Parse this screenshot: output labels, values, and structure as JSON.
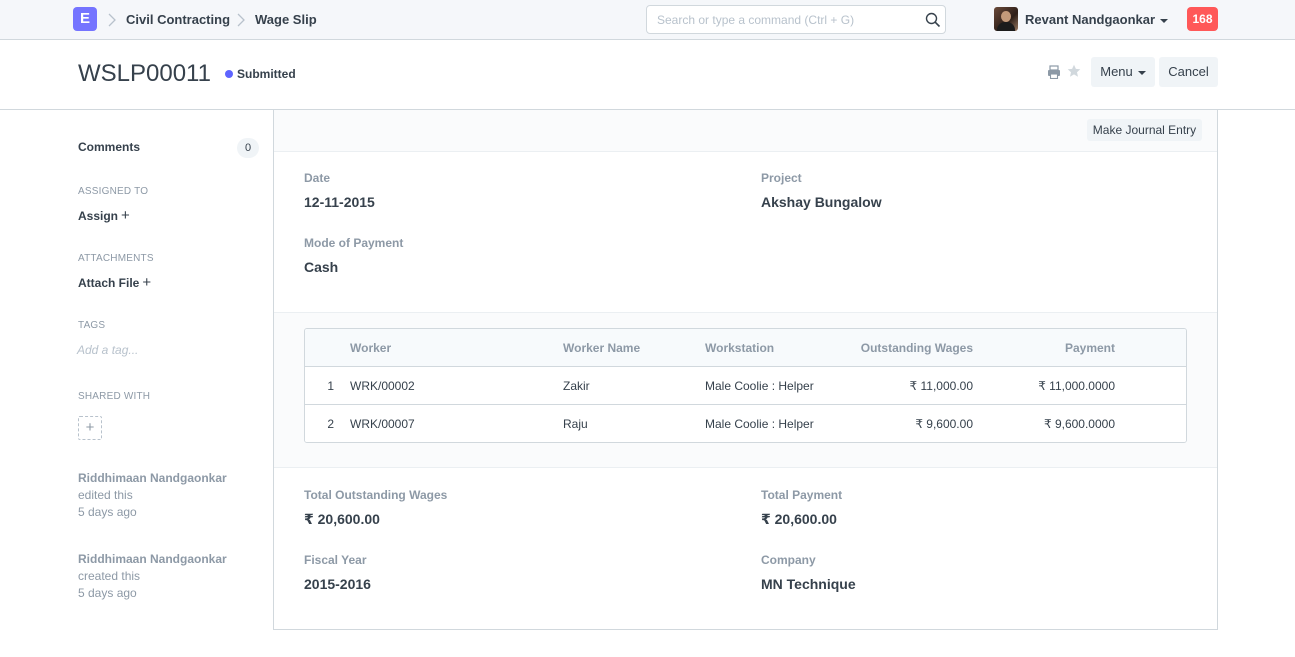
{
  "navbar": {
    "logo_letter": "E",
    "breadcrumbs": [
      "Civil Contracting",
      "Wage Slip"
    ],
    "search_placeholder": "Search or type a command (Ctrl + G)",
    "user_name": "Revant Nandgaonkar",
    "notification_count": "168"
  },
  "page_head": {
    "title": "WSLP00011",
    "status": "Submitted",
    "status_color": "#5e64ff",
    "menu_label": "Menu",
    "cancel_label": "Cancel"
  },
  "sidebar": {
    "comments_label": "Comments",
    "comments_count": "0",
    "assigned_heading": "ASSIGNED TO",
    "assign_label": "Assign",
    "attachments_heading": "ATTACHMENTS",
    "attach_label": "Attach File",
    "tags_heading": "TAGS",
    "tag_placeholder": "Add a tag...",
    "shared_heading": "SHARED WITH",
    "timeline": [
      {
        "name": "Riddhimaan Nandgaonkar",
        "action": "edited this",
        "when": "5 days ago"
      },
      {
        "name": "Riddhimaan Nandgaonkar",
        "action": "created this",
        "when": "5 days ago"
      }
    ]
  },
  "form": {
    "toolbar_button": "Make Journal Entry",
    "date_label": "Date",
    "date_value": "12-11-2015",
    "project_label": "Project",
    "project_value": "Akshay Bungalow",
    "mode_label": "Mode of Payment",
    "mode_value": "Cash",
    "table": {
      "columns": [
        "Worker",
        "Worker Name",
        "Workstation",
        "Outstanding Wages",
        "Payment"
      ],
      "rows": [
        {
          "idx": "1",
          "worker": "WRK/00002",
          "worker_name": "Zakir",
          "workstation": "Male Coolie : Helper",
          "outstanding": "₹ 11,000.00",
          "payment": "₹ 11,000.0000"
        },
        {
          "idx": "2",
          "worker": "WRK/00007",
          "worker_name": "Raju",
          "workstation": "Male Coolie : Helper",
          "outstanding": "₹ 9,600.00",
          "payment": "₹ 9,600.0000"
        }
      ]
    },
    "total_outstanding_label": "Total Outstanding Wages",
    "total_outstanding_value": "₹ 20,600.00",
    "total_payment_label": "Total Payment",
    "total_payment_value": "₹ 20,600.00",
    "fiscal_year_label": "Fiscal Year",
    "fiscal_year_value": "2015-2016",
    "company_label": "Company",
    "company_value": "MN Technique"
  },
  "colors": {
    "logo": "#7574ff",
    "badge": "#ff5858"
  }
}
